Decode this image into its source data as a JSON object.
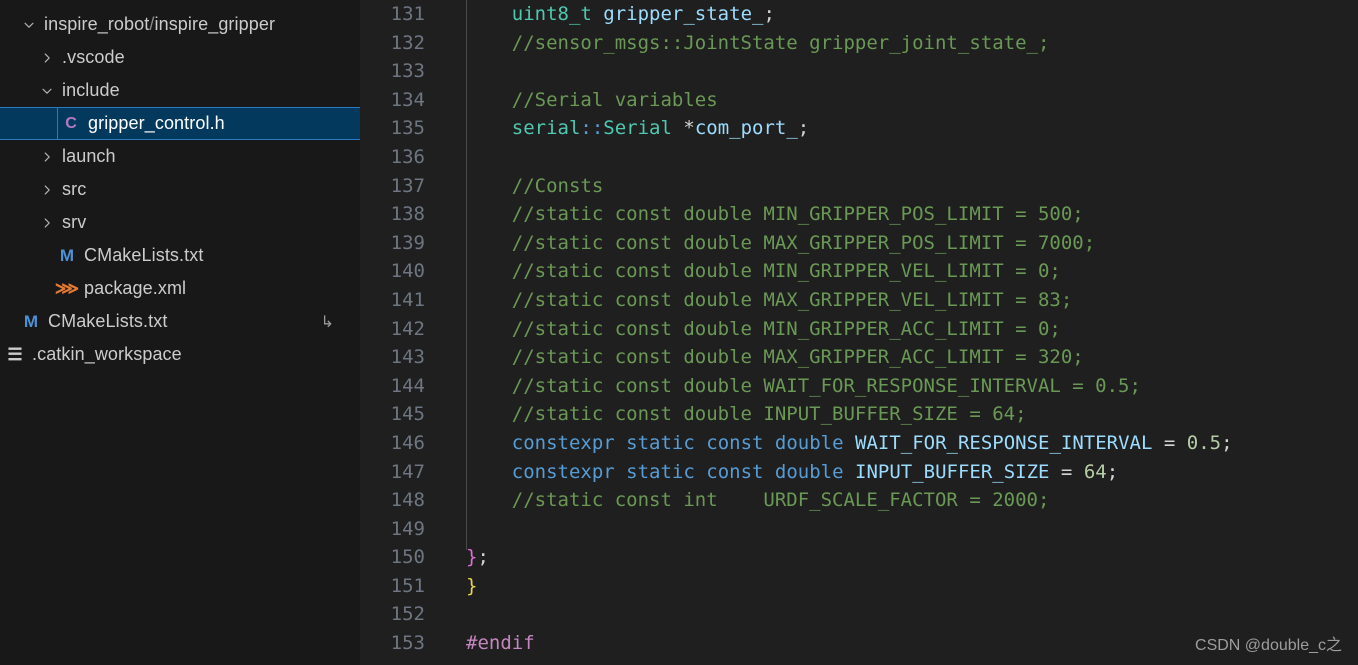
{
  "sidebar": {
    "items": [
      {
        "label": "inspire_robot",
        "label2": "inspire_gripper",
        "separator": "/",
        "twisty": "chevron-down-icon",
        "icon": null,
        "indent": "ind0",
        "selected": false,
        "name": "tree-item-inspire-robot-inspire-gripper"
      },
      {
        "label": ".vscode",
        "twisty": "chevron-right-icon",
        "icon": null,
        "indent": "ind1",
        "selected": false,
        "name": "tree-item-vscode"
      },
      {
        "label": "include",
        "twisty": "chevron-down-icon",
        "icon": null,
        "indent": "ind1",
        "selected": false,
        "name": "tree-item-include"
      },
      {
        "label": "gripper_control.h",
        "twisty": null,
        "icon": "c-file-icon",
        "icon_glyph": "C",
        "icon_class": "c-icon",
        "indent": "ind3",
        "selected": true,
        "name": "tree-item-gripper-control-h"
      },
      {
        "label": "launch",
        "twisty": "chevron-right-icon",
        "icon": null,
        "indent": "ind1",
        "selected": false,
        "name": "tree-item-launch"
      },
      {
        "label": "src",
        "twisty": "chevron-right-icon",
        "icon": null,
        "indent": "ind1",
        "selected": false,
        "name": "tree-item-src"
      },
      {
        "label": "srv",
        "twisty": "chevron-right-icon",
        "icon": null,
        "indent": "ind1",
        "selected": false,
        "name": "tree-item-srv"
      },
      {
        "label": "CMakeLists.txt",
        "twisty": null,
        "icon": "cmake-file-icon",
        "icon_glyph": "M",
        "icon_class": "m-icon",
        "indent": "ind2",
        "selected": false,
        "name": "tree-item-cmakelists-inner"
      },
      {
        "label": "package.xml",
        "twisty": null,
        "icon": "xml-file-icon",
        "icon_glyph": "⋙",
        "icon_class": "x-icon",
        "indent": "ind2",
        "selected": false,
        "name": "tree-item-package-xml"
      },
      {
        "label": "CMakeLists.txt",
        "twisty": null,
        "icon": "cmake-file-icon",
        "icon_glyph": "M",
        "icon_class": "m-icon",
        "indent": "ind0",
        "selected": false,
        "badge": "↳",
        "name": "tree-item-cmakelists-root"
      },
      {
        "label": ".catkin_workspace",
        "twisty": null,
        "icon": "text-file-icon",
        "icon_glyph": "☰",
        "icon_class": "list-icon",
        "indent": "indm1",
        "selected": false,
        "name": "tree-item-catkin-workspace"
      }
    ]
  },
  "editor": {
    "first_line": 131,
    "lines": [
      {
        "n": "131",
        "tokens": [
          {
            "t": "    ",
            "c": "tok-pln"
          },
          {
            "t": "uint8_t",
            "c": "tok-type"
          },
          {
            "t": " ",
            "c": "tok-pln"
          },
          {
            "t": "gripper_state_",
            "c": "tok-id"
          },
          {
            "t": ";",
            "c": "tok-pln"
          }
        ]
      },
      {
        "n": "132",
        "tokens": [
          {
            "t": "    //sensor_msgs::JointState gripper_joint_state_;",
            "c": "tok-cmt"
          }
        ]
      },
      {
        "n": "133",
        "tokens": []
      },
      {
        "n": "134",
        "tokens": [
          {
            "t": "    //Serial variables",
            "c": "tok-cmt"
          }
        ]
      },
      {
        "n": "135",
        "tokens": [
          {
            "t": "    ",
            "c": "tok-pln"
          },
          {
            "t": "serial",
            "c": "tok-type"
          },
          {
            "t": "::",
            "c": "tok-kw"
          },
          {
            "t": "Serial",
            "c": "tok-type"
          },
          {
            "t": " *",
            "c": "tok-pln"
          },
          {
            "t": "com_port_",
            "c": "tok-id"
          },
          {
            "t": ";",
            "c": "tok-pln"
          }
        ]
      },
      {
        "n": "136",
        "tokens": []
      },
      {
        "n": "137",
        "tokens": [
          {
            "t": "    //Consts",
            "c": "tok-cmt"
          }
        ]
      },
      {
        "n": "138",
        "tokens": [
          {
            "t": "    //static const double MIN_GRIPPER_POS_LIMIT = 500;",
            "c": "tok-cmt"
          }
        ]
      },
      {
        "n": "139",
        "tokens": [
          {
            "t": "    //static const double MAX_GRIPPER_POS_LIMIT = 7000;",
            "c": "tok-cmt"
          }
        ]
      },
      {
        "n": "140",
        "tokens": [
          {
            "t": "    //static const double MIN_GRIPPER_VEL_LIMIT = 0;",
            "c": "tok-cmt"
          }
        ]
      },
      {
        "n": "141",
        "tokens": [
          {
            "t": "    //static const double MAX_GRIPPER_VEL_LIMIT = 83;",
            "c": "tok-cmt"
          }
        ]
      },
      {
        "n": "142",
        "tokens": [
          {
            "t": "    //static const double MIN_GRIPPER_ACC_LIMIT = 0;",
            "c": "tok-cmt"
          }
        ]
      },
      {
        "n": "143",
        "tokens": [
          {
            "t": "    //static const double MAX_GRIPPER_ACC_LIMIT = 320;",
            "c": "tok-cmt"
          }
        ]
      },
      {
        "n": "144",
        "tokens": [
          {
            "t": "    //static const double WAIT_FOR_RESPONSE_INTERVAL = 0.5;",
            "c": "tok-cmt"
          }
        ]
      },
      {
        "n": "145",
        "tokens": [
          {
            "t": "    //static const double INPUT_BUFFER_SIZE = 64;",
            "c": "tok-cmt"
          }
        ]
      },
      {
        "n": "146",
        "tokens": [
          {
            "t": "    ",
            "c": "tok-pln"
          },
          {
            "t": "constexpr",
            "c": "tok-kw"
          },
          {
            "t": " ",
            "c": "tok-pln"
          },
          {
            "t": "static",
            "c": "tok-kw"
          },
          {
            "t": " ",
            "c": "tok-pln"
          },
          {
            "t": "const",
            "c": "tok-kw"
          },
          {
            "t": " ",
            "c": "tok-pln"
          },
          {
            "t": "double",
            "c": "tok-kw"
          },
          {
            "t": " ",
            "c": "tok-pln"
          },
          {
            "t": "WAIT_FOR_RESPONSE_INTERVAL",
            "c": "tok-id"
          },
          {
            "t": " = ",
            "c": "tok-pln"
          },
          {
            "t": "0.5",
            "c": "tok-num"
          },
          {
            "t": ";",
            "c": "tok-pln"
          }
        ]
      },
      {
        "n": "147",
        "tokens": [
          {
            "t": "    ",
            "c": "tok-pln"
          },
          {
            "t": "constexpr",
            "c": "tok-kw"
          },
          {
            "t": " ",
            "c": "tok-pln"
          },
          {
            "t": "static",
            "c": "tok-kw"
          },
          {
            "t": " ",
            "c": "tok-pln"
          },
          {
            "t": "const",
            "c": "tok-kw"
          },
          {
            "t": " ",
            "c": "tok-pln"
          },
          {
            "t": "double",
            "c": "tok-kw"
          },
          {
            "t": " ",
            "c": "tok-pln"
          },
          {
            "t": "INPUT_BUFFER_SIZE",
            "c": "tok-id"
          },
          {
            "t": " = ",
            "c": "tok-pln"
          },
          {
            "t": "64",
            "c": "tok-num"
          },
          {
            "t": ";",
            "c": "tok-pln"
          }
        ]
      },
      {
        "n": "148",
        "tokens": [
          {
            "t": "    //static const int    URDF_SCALE_FACTOR = 2000;",
            "c": "tok-cmt"
          }
        ]
      },
      {
        "n": "149",
        "tokens": []
      },
      {
        "n": "150",
        "tokens": [
          {
            "t": "}",
            "c": "tok-br1"
          },
          {
            "t": ";",
            "c": "tok-pln"
          }
        ]
      },
      {
        "n": "151",
        "tokens": [
          {
            "t": "}",
            "c": "tok-br2"
          }
        ]
      },
      {
        "n": "152",
        "tokens": []
      },
      {
        "n": "153",
        "tokens": [
          {
            "t": "#endif",
            "c": "tok-pre"
          }
        ]
      }
    ]
  },
  "watermark": {
    "text": "CSDN @double_c之"
  },
  "colors": {
    "sidebar_bg": "#181818",
    "editor_bg": "#1f1f1f",
    "selection_bg": "#04395e",
    "selection_border": "#2b79c2",
    "comment": "#6a9955",
    "keyword": "#569cd6",
    "type": "#4ec9b0",
    "identifier": "#9cdcfe",
    "number": "#b5cea8",
    "preprocessor": "#c586c0",
    "line_number": "#6e7681"
  }
}
